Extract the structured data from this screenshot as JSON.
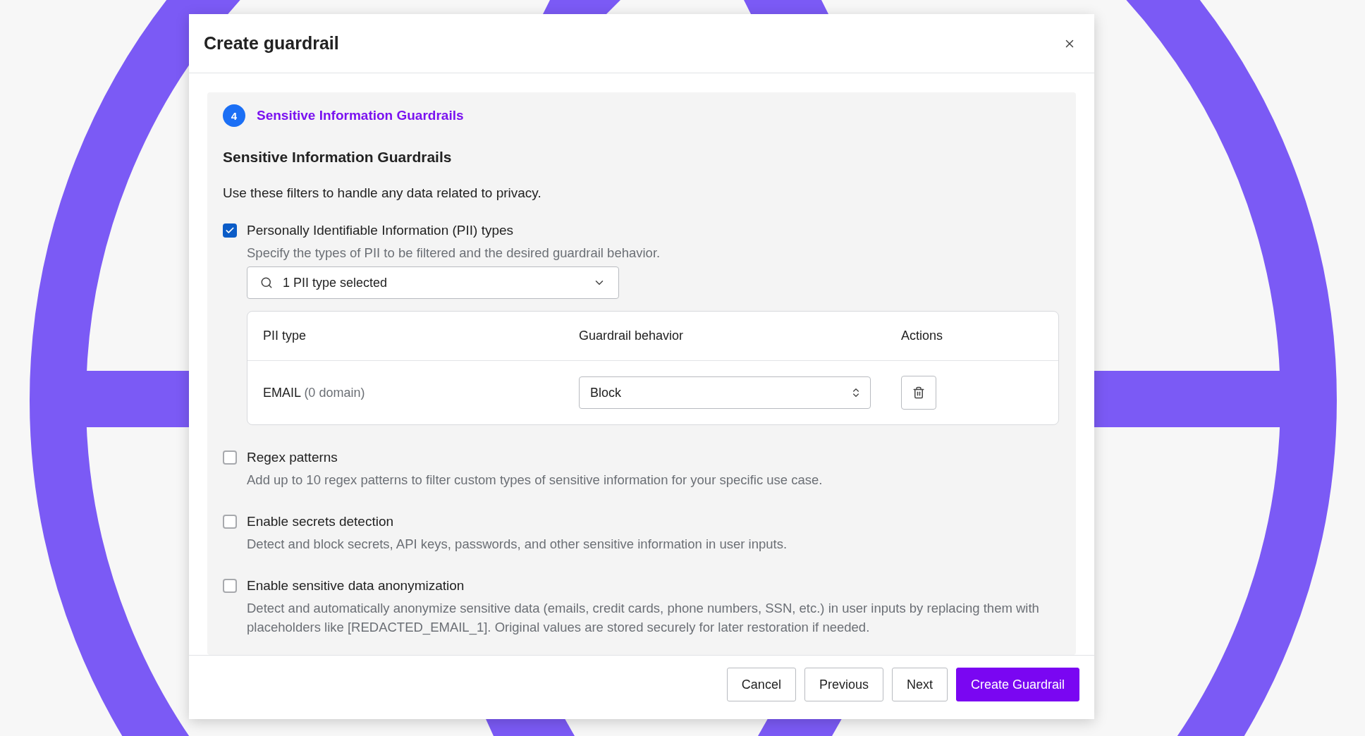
{
  "dialog": {
    "title": "Create guardrail"
  },
  "step": {
    "number": "4",
    "title": "Sensitive Information Guardrails"
  },
  "section": {
    "heading": "Sensitive Information Guardrails",
    "intro": "Use these filters to handle any data related to privacy."
  },
  "filters": [
    {
      "label": "Personally Identifiable Information (PII) types",
      "description": "Specify the types of PII to be filtered and the desired guardrail behavior.",
      "checked": true,
      "selector": {
        "value": "1 PII type selected"
      },
      "table": {
        "columns": [
          "PII type",
          "Guardrail behavior",
          "Actions"
        ],
        "rows": [
          {
            "type": "EMAIL",
            "detail": "(0 domain)",
            "behavior": "Block"
          }
        ]
      }
    },
    {
      "label": "Regex patterns",
      "description": "Add up to 10 regex patterns to filter custom types of sensitive information for your specific use case.",
      "checked": false
    },
    {
      "label": "Enable secrets detection",
      "description": "Detect and block secrets, API keys, passwords, and other sensitive information in user inputs.",
      "checked": false
    },
    {
      "label": "Enable sensitive data anonymization",
      "description": "Detect and automatically anonymize sensitive data (emails, credit cards, phone numbers, SSN, etc.) in user inputs by replacing them with placeholders like [REDACTED_EMAIL_1]. Original values are stored securely for later restoration if needed.",
      "checked": false
    }
  ],
  "buttons": [
    {
      "label": "Cancel",
      "kind": "secondary"
    },
    {
      "label": "Previous",
      "kind": "secondary"
    },
    {
      "label": "Next",
      "kind": "secondary"
    },
    {
      "label": "Create Guardrail",
      "kind": "primary"
    }
  ]
}
